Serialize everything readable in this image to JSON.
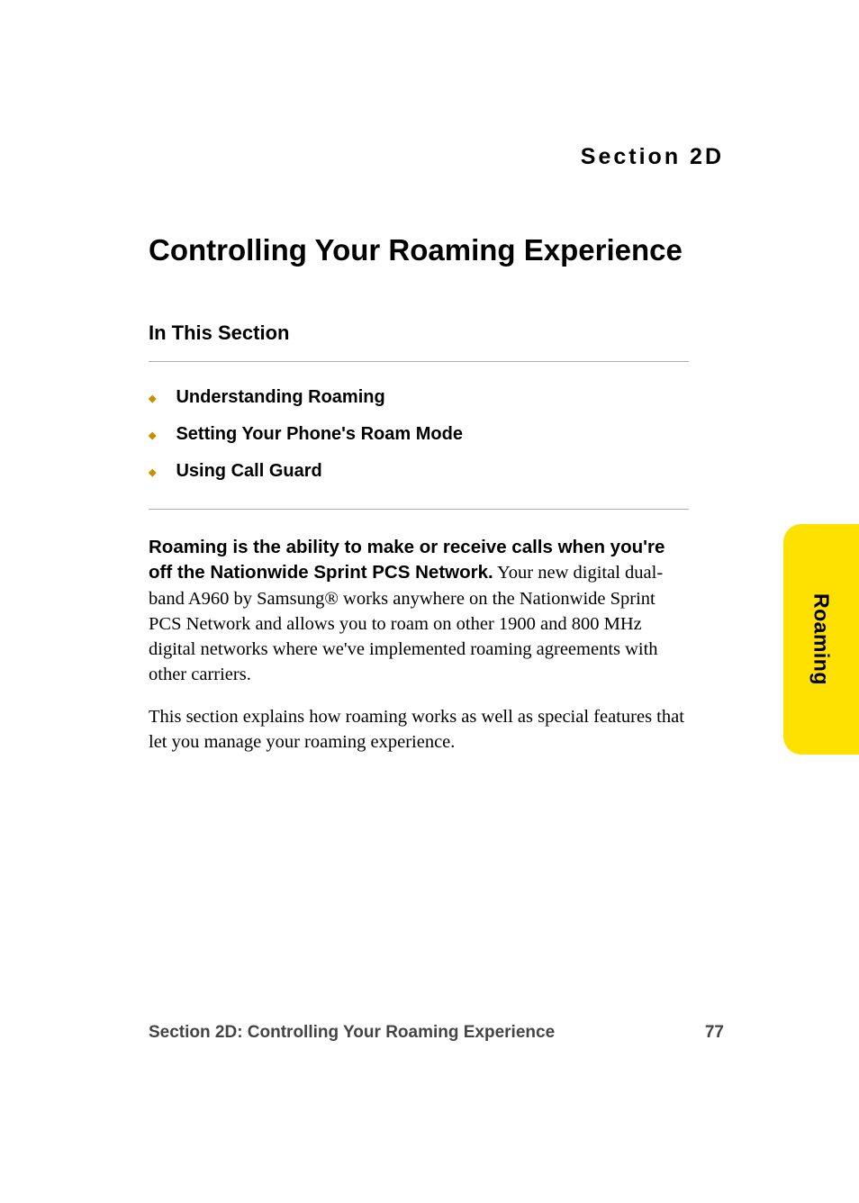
{
  "sectionLabel": "Section 2D",
  "pageTitle": "Controlling Your Roaming Experience",
  "subsectionHeading": "In This Section",
  "bullets": [
    "Understanding Roaming",
    "Setting Your Phone's Roam Mode",
    "Using Call Guard"
  ],
  "paragraph1Lead": "Roaming is the ability to make or receive calls when you're off the Nationwide Sprint PCS Network.",
  "paragraph1Rest": " Your new digital dual-band A960 by Samsung® works anywhere on the Nationwide Sprint PCS Network and allows you to roam on other 1900 and 800 MHz digital networks where we've implemented roaming agreements with other carriers.",
  "paragraph2": "This section explains how roaming works as well as special features that let you manage your roaming experience.",
  "sideTab": "Roaming",
  "footerLeft": "Section 2D: Controlling Your Roaming Experience",
  "footerRight": "77"
}
